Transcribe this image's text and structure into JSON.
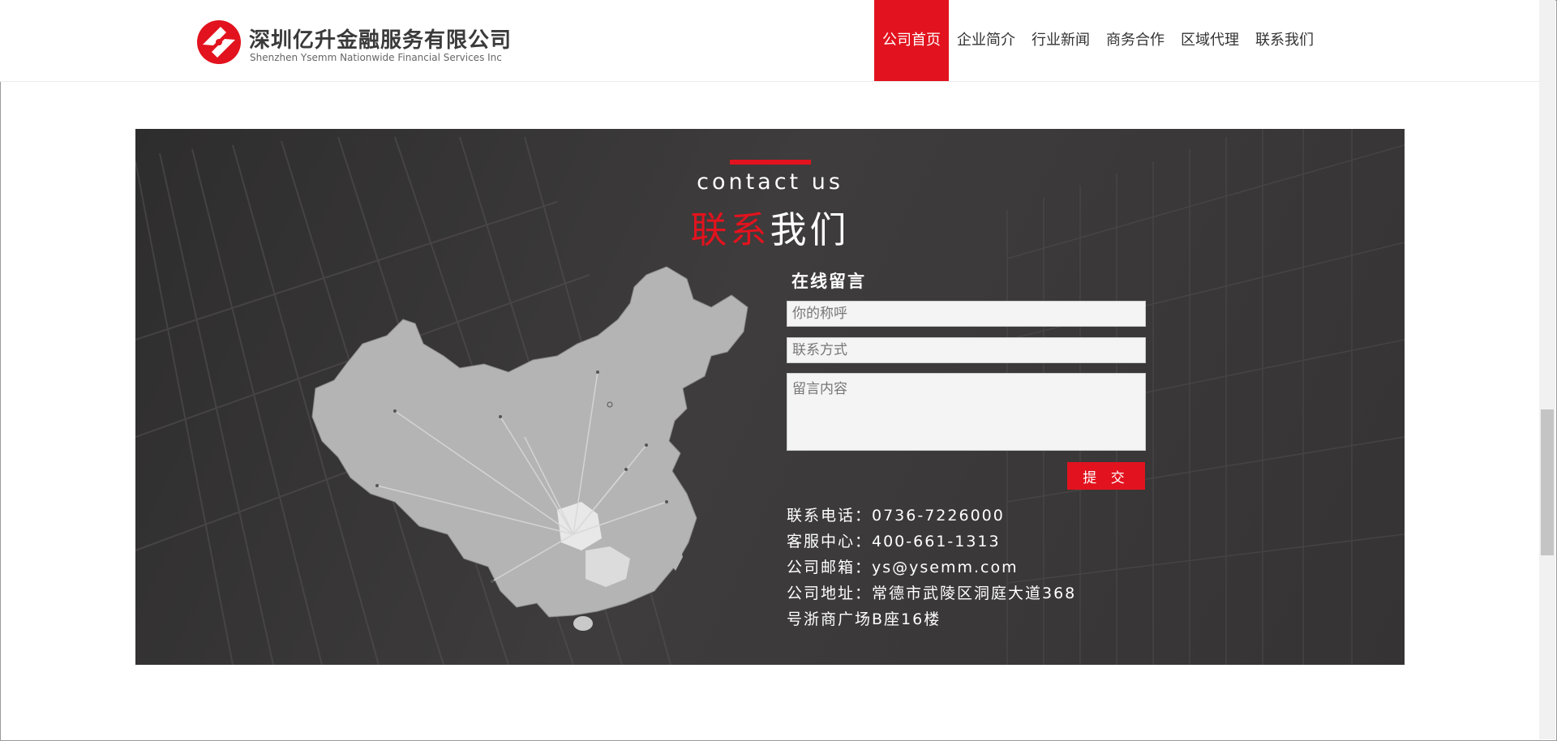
{
  "header": {
    "company_name_cn": "深圳亿升金融服务有限公司",
    "company_name_en": "Shenzhen Ysemm Nationwide Financial Services Inc",
    "nav": [
      {
        "label": "公司首页",
        "active": true
      },
      {
        "label": "企业简介",
        "active": false
      },
      {
        "label": "行业新闻",
        "active": false
      },
      {
        "label": "商务合作",
        "active": false
      },
      {
        "label": "区域代理",
        "active": false
      },
      {
        "label": "联系我们",
        "active": false
      }
    ]
  },
  "contact": {
    "title_en": "contact us",
    "title_cn_red": "联系",
    "title_cn_white": "我们",
    "form": {
      "title": "在线留言",
      "name_placeholder": "你的称呼",
      "contact_placeholder": "联系方式",
      "message_placeholder": "留言内容",
      "submit_label": "提 交"
    },
    "info": {
      "phone": "联系电话：0736-7226000",
      "service": "客服中心：400-661-1313",
      "email": "公司邮箱：ys@ysemm.com",
      "address_line1": "公司地址：常德市武陵区洞庭大道368",
      "address_line2": "号浙商广场B座16楼"
    }
  },
  "colors": {
    "accent": "#e2131e",
    "panel_bg": "#363434",
    "map_fill": "#b4b4b4",
    "map_highlight": "#e6e6e6"
  },
  "icons": [
    "logo-mark-icon",
    "china-map-graphic"
  ]
}
